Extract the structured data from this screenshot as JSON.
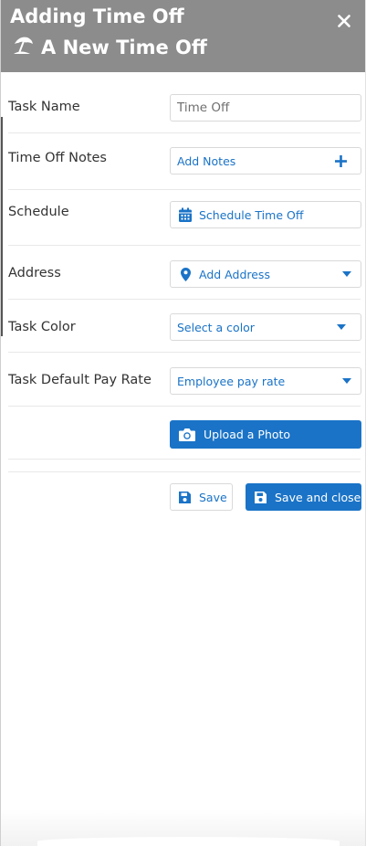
{
  "header": {
    "title": "Adding Time Off",
    "subtitle": "A New Time Off",
    "subtitle_icon": "beach-umbrella-icon",
    "close_icon": "close-icon"
  },
  "form": {
    "task_name": {
      "label": "Task Name",
      "value": "Time Off"
    },
    "notes": {
      "label": "Time Off Notes",
      "button": "Add Notes",
      "icon": "plus-icon"
    },
    "schedule": {
      "label": "Schedule",
      "button": "Schedule Time Off",
      "icon": "calendar-icon"
    },
    "address": {
      "label": "Address",
      "value": "Add Address",
      "icon": "map-pin-icon"
    },
    "color": {
      "label": "Task Color",
      "value": "Select a color"
    },
    "pay_rate": {
      "label": "Task Default Pay Rate",
      "value": "Employee pay rate"
    },
    "upload": {
      "label": "Upload a Photo",
      "icon": "camera-icon"
    }
  },
  "actions": {
    "save": "Save",
    "save_close": "Save and close",
    "save_icon": "floppy-disk-icon"
  },
  "colors": {
    "header_bg": "#8c8c8c",
    "accent": "#1a73c7",
    "border": "#d9d9d9"
  }
}
